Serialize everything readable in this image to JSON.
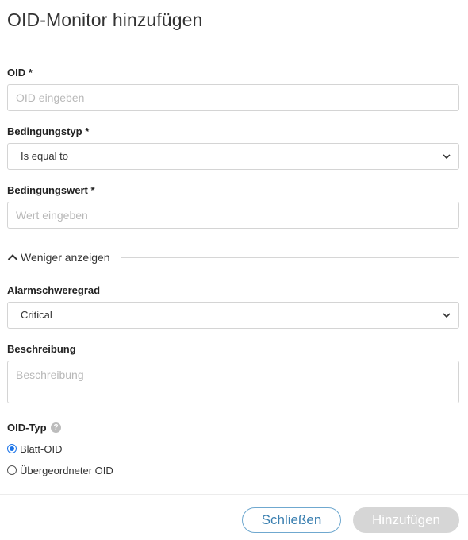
{
  "dialog": {
    "title": "OID-Monitor hinzufügen"
  },
  "form": {
    "oid": {
      "label": "OID *",
      "placeholder": "OID eingeben",
      "value": ""
    },
    "condition_type": {
      "label": "Bedingungstyp *",
      "selected": "Is equal to"
    },
    "condition_value": {
      "label": "Bedingungswert *",
      "placeholder": "Wert eingeben",
      "value": ""
    },
    "toggle_label": "Weniger anzeigen",
    "severity": {
      "label": "Alarmschweregrad",
      "selected": "Critical"
    },
    "description": {
      "label": "Beschreibung",
      "placeholder": "Beschreibung",
      "value": ""
    },
    "oid_type": {
      "label": "OID-Typ",
      "help_icon": "?",
      "options": [
        {
          "label": "Blatt-OID",
          "checked": true
        },
        {
          "label": "Übergeordneter OID",
          "checked": false
        }
      ]
    }
  },
  "footer": {
    "close_label": "Schließen",
    "add_label": "Hinzufügen"
  },
  "colors": {
    "accent": "#1a73e8",
    "close_border": "#6fa8cf",
    "disabled_button": "#d6d6d6"
  },
  "icons": {
    "select_chevron": "chevron-down-icon",
    "toggle_caret": "chevron-up-icon",
    "help": "help-circle-icon"
  }
}
